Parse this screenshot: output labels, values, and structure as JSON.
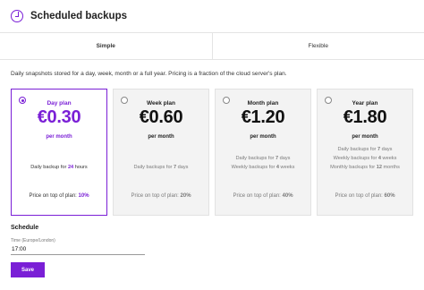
{
  "header": {
    "title": "Scheduled backups",
    "icon": "backup-clock-icon"
  },
  "tabs": [
    {
      "label": "Simple",
      "active": true
    },
    {
      "label": "Flexible",
      "active": false
    }
  ],
  "description": "Daily snapshots stored for a day, week, month or a full year. Pricing is a fraction of the cloud server's plan.",
  "plans": [
    {
      "name": "Day plan",
      "price": "€0.30",
      "per": "per month",
      "selected": true,
      "lines": [
        {
          "text": "Daily backup for ",
          "bold": "24",
          "suffix": " hours"
        }
      ],
      "price_note": "Price on top of plan: ",
      "percent": "10%"
    },
    {
      "name": "Week plan",
      "price": "€0.60",
      "per": "per month",
      "selected": false,
      "lines": [
        {
          "text": "Daily backups for ",
          "bold": "7",
          "suffix": " days"
        }
      ],
      "price_note": "Price on top of plan: ",
      "percent": "20%"
    },
    {
      "name": "Month plan",
      "price": "€1.20",
      "per": "per month",
      "selected": false,
      "lines": [
        {
          "text": "Daily backups for ",
          "bold": "7",
          "suffix": " days"
        },
        {
          "text": "Weekly backups for ",
          "bold": "4",
          "suffix": " weeks"
        }
      ],
      "price_note": "Price on top of plan: ",
      "percent": "40%"
    },
    {
      "name": "Year plan",
      "price": "€1.80",
      "per": "per month",
      "selected": false,
      "lines": [
        {
          "text": "Daily backups for ",
          "bold": "7",
          "suffix": " days"
        },
        {
          "text": "Weekly backups for ",
          "bold": "4",
          "suffix": " weeks"
        },
        {
          "text": "Monthly backups for ",
          "bold": "12",
          "suffix": " months"
        }
      ],
      "price_note": "Price on top of plan: ",
      "percent": "60%"
    }
  ],
  "schedule": {
    "title": "Schedule",
    "time_label": "Time (Europe/London)",
    "time_value": "17:00"
  },
  "save_label": "Save",
  "colors": {
    "accent": "#7a1fd6"
  }
}
